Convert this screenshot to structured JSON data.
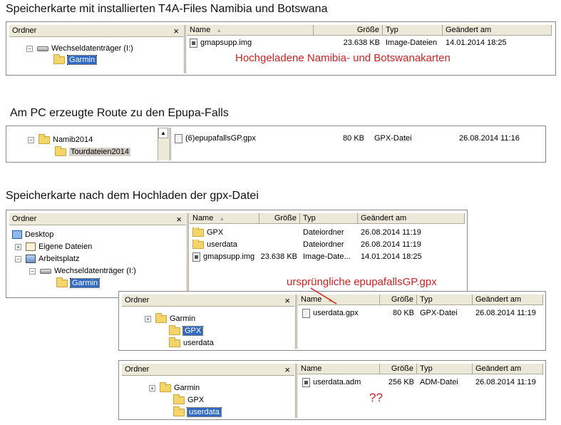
{
  "section1": {
    "title": "Speicherkarte mit installierten T4A-Files Namibia und Botswana",
    "folder_pane": {
      "header": "Ordner",
      "close": "×"
    },
    "tree": [
      {
        "label": "Wechseldatenträger (I:)",
        "expander": "−",
        "icon": "drive-icon"
      },
      {
        "label": "Garmin",
        "icon": "folder-icon",
        "selected": true
      }
    ],
    "columns": {
      "name": "Name",
      "size": "Größe",
      "type": "Typ",
      "modified": "Geändert am"
    },
    "rows": [
      {
        "name": "gmapsupp.img",
        "size": "23.638 KB",
        "type": "Image-Dateien",
        "modified": "14.01.2014 18:25"
      }
    ],
    "annotation": "Hochgeladene Namibia- und Botswanakarten"
  },
  "section2": {
    "title": "Am PC erzeugte Route zu den Epupa-Falls",
    "tree": [
      {
        "label": "Namib2014",
        "expander": "−",
        "icon": "folder-icon"
      },
      {
        "label": "Tourdateien2014",
        "icon": "folder-icon"
      }
    ],
    "scroll_up": "▲",
    "rows": [
      {
        "name": "(6)epupafallsGP.gpx",
        "size": "80 KB",
        "type": "GPX-Datei",
        "modified": "26.08.2014 11:16"
      }
    ]
  },
  "section3": {
    "title": "Speicherkarte nach dem Hochladen der gpx-Datei",
    "main": {
      "folder_pane": {
        "header": "Ordner",
        "close": "×"
      },
      "tree": [
        {
          "label": "Desktop",
          "icon": "desktop-icon"
        },
        {
          "label": "Eigene Dateien",
          "expander": "+",
          "icon": "documents-icon"
        },
        {
          "label": "Arbeitsplatz",
          "expander": "−",
          "icon": "computer-icon"
        },
        {
          "label": "Wechseldatenträger (I:)",
          "expander": "−",
          "icon": "drive-icon"
        },
        {
          "label": "Garmin",
          "icon": "folder-icon",
          "selected": true
        }
      ],
      "columns": {
        "name": "Name",
        "size": "Größe",
        "type": "Typ",
        "modified": "Geändert am"
      },
      "rows": [
        {
          "name": "GPX",
          "size": "",
          "type": "Dateiordner",
          "modified": "26.08.2014 11:19"
        },
        {
          "name": "userdata",
          "size": "",
          "type": "Dateiordner",
          "modified": "26.08.2014 11:19"
        },
        {
          "name": "gmapsupp.img",
          "size": "23.638 KB",
          "type": "Image-Date...",
          "modified": "14.01.2014 18:25"
        }
      ]
    },
    "gpx_window": {
      "folder_pane": {
        "header": "Ordner",
        "close": "×"
      },
      "tree": [
        {
          "label": "Garmin",
          "expander": "+",
          "icon": "folder-icon"
        },
        {
          "label": "GPX",
          "icon": "folder-icon",
          "selected": true
        },
        {
          "label": "userdata",
          "icon": "folder-icon"
        }
      ],
      "columns": {
        "name": "Name",
        "size": "Größe",
        "type": "Typ",
        "modified": "Geändert am"
      },
      "rows": [
        {
          "name": "userdata.gpx",
          "size": "80 KB",
          "type": "GPX-Datei",
          "modified": "26.08.2014 11:19"
        }
      ],
      "annotation": "ursprüngliche epupafallsGP.gpx"
    },
    "userdata_window": {
      "folder_pane": {
        "header": "Ordner",
        "close": "×"
      },
      "tree": [
        {
          "label": "Garmin",
          "expander": "+",
          "icon": "folder-icon"
        },
        {
          "label": "GPX",
          "icon": "folder-icon"
        },
        {
          "label": "userdata",
          "icon": "folder-icon",
          "selected": true
        }
      ],
      "columns": {
        "name": "Name",
        "size": "Größe",
        "type": "Typ",
        "modified": "Geändert am"
      },
      "rows": [
        {
          "name": "userdata.adm",
          "size": "256 KB",
          "type": "ADM-Datei",
          "modified": "26.08.2014 11:19"
        }
      ],
      "annotation": "??"
    }
  },
  "colors": {
    "annotation_red": "#d42020",
    "selection_blue": "#316ac5",
    "header_bg": "#ece9d8"
  }
}
